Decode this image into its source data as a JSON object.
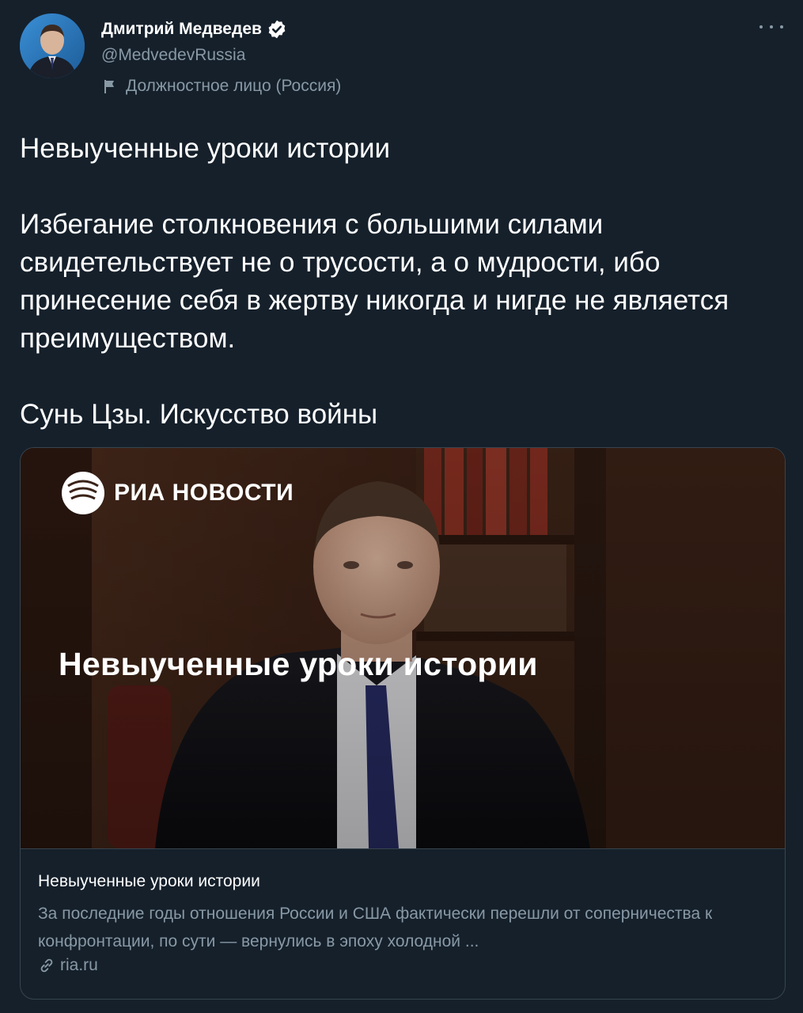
{
  "author": {
    "name": "Дмитрий Медведев",
    "handle": "@MedvedevRussia",
    "affiliation": "Должностное лицо (Россия)",
    "avatar_icon": "person-portrait-icon",
    "verified_icon": "verified-badge-icon"
  },
  "tweet": {
    "paragraphs": [
      "Невыученные уроки истории",
      "Избегание столкновения с большими силами свидетельствует не о трусости, а о мудрости, ибо принесение себя в жертву никогда и нигде не является преимуществом.",
      "Сунь Цзы. Искусство войны"
    ]
  },
  "card": {
    "image": {
      "logo_text": "РИА НОВОСТИ",
      "headline": "Невыученные уроки истории"
    },
    "title": "Невыученные уроки истории",
    "description": "За последние годы отношения России и США фактически перешли от соперничества к конфронтации, по сути — вернулись в эпоху холодной ...",
    "domain": "ria.ru"
  },
  "colors": {
    "background": "#15202b",
    "text_primary": "#ffffff",
    "text_secondary": "#8899a6",
    "border": "#38444d"
  }
}
